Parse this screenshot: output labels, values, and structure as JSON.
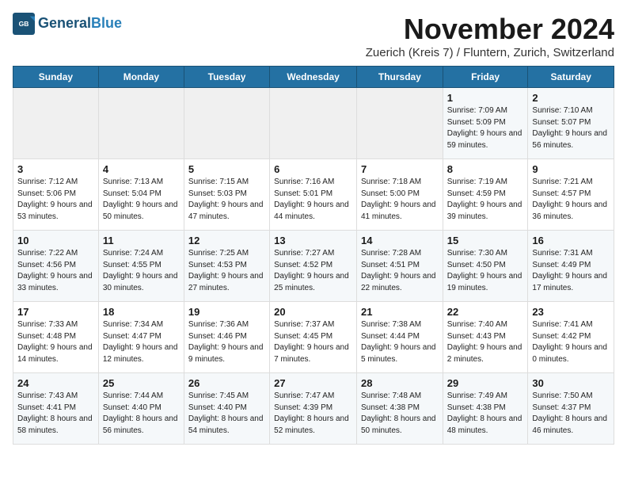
{
  "header": {
    "logo_line1": "General",
    "logo_line2": "Blue",
    "month_title": "November 2024",
    "location": "Zuerich (Kreis 7) / Fluntern, Zurich, Switzerland"
  },
  "days_of_week": [
    "Sunday",
    "Monday",
    "Tuesday",
    "Wednesday",
    "Thursday",
    "Friday",
    "Saturday"
  ],
  "weeks": [
    [
      {
        "day": "",
        "info": ""
      },
      {
        "day": "",
        "info": ""
      },
      {
        "day": "",
        "info": ""
      },
      {
        "day": "",
        "info": ""
      },
      {
        "day": "",
        "info": ""
      },
      {
        "day": "1",
        "info": "Sunrise: 7:09 AM\nSunset: 5:09 PM\nDaylight: 9 hours and 59 minutes."
      },
      {
        "day": "2",
        "info": "Sunrise: 7:10 AM\nSunset: 5:07 PM\nDaylight: 9 hours and 56 minutes."
      }
    ],
    [
      {
        "day": "3",
        "info": "Sunrise: 7:12 AM\nSunset: 5:06 PM\nDaylight: 9 hours and 53 minutes."
      },
      {
        "day": "4",
        "info": "Sunrise: 7:13 AM\nSunset: 5:04 PM\nDaylight: 9 hours and 50 minutes."
      },
      {
        "day": "5",
        "info": "Sunrise: 7:15 AM\nSunset: 5:03 PM\nDaylight: 9 hours and 47 minutes."
      },
      {
        "day": "6",
        "info": "Sunrise: 7:16 AM\nSunset: 5:01 PM\nDaylight: 9 hours and 44 minutes."
      },
      {
        "day": "7",
        "info": "Sunrise: 7:18 AM\nSunset: 5:00 PM\nDaylight: 9 hours and 41 minutes."
      },
      {
        "day": "8",
        "info": "Sunrise: 7:19 AM\nSunset: 4:59 PM\nDaylight: 9 hours and 39 minutes."
      },
      {
        "day": "9",
        "info": "Sunrise: 7:21 AM\nSunset: 4:57 PM\nDaylight: 9 hours and 36 minutes."
      }
    ],
    [
      {
        "day": "10",
        "info": "Sunrise: 7:22 AM\nSunset: 4:56 PM\nDaylight: 9 hours and 33 minutes."
      },
      {
        "day": "11",
        "info": "Sunrise: 7:24 AM\nSunset: 4:55 PM\nDaylight: 9 hours and 30 minutes."
      },
      {
        "day": "12",
        "info": "Sunrise: 7:25 AM\nSunset: 4:53 PM\nDaylight: 9 hours and 27 minutes."
      },
      {
        "day": "13",
        "info": "Sunrise: 7:27 AM\nSunset: 4:52 PM\nDaylight: 9 hours and 25 minutes."
      },
      {
        "day": "14",
        "info": "Sunrise: 7:28 AM\nSunset: 4:51 PM\nDaylight: 9 hours and 22 minutes."
      },
      {
        "day": "15",
        "info": "Sunrise: 7:30 AM\nSunset: 4:50 PM\nDaylight: 9 hours and 19 minutes."
      },
      {
        "day": "16",
        "info": "Sunrise: 7:31 AM\nSunset: 4:49 PM\nDaylight: 9 hours and 17 minutes."
      }
    ],
    [
      {
        "day": "17",
        "info": "Sunrise: 7:33 AM\nSunset: 4:48 PM\nDaylight: 9 hours and 14 minutes."
      },
      {
        "day": "18",
        "info": "Sunrise: 7:34 AM\nSunset: 4:47 PM\nDaylight: 9 hours and 12 minutes."
      },
      {
        "day": "19",
        "info": "Sunrise: 7:36 AM\nSunset: 4:46 PM\nDaylight: 9 hours and 9 minutes."
      },
      {
        "day": "20",
        "info": "Sunrise: 7:37 AM\nSunset: 4:45 PM\nDaylight: 9 hours and 7 minutes."
      },
      {
        "day": "21",
        "info": "Sunrise: 7:38 AM\nSunset: 4:44 PM\nDaylight: 9 hours and 5 minutes."
      },
      {
        "day": "22",
        "info": "Sunrise: 7:40 AM\nSunset: 4:43 PM\nDaylight: 9 hours and 2 minutes."
      },
      {
        "day": "23",
        "info": "Sunrise: 7:41 AM\nSunset: 4:42 PM\nDaylight: 9 hours and 0 minutes."
      }
    ],
    [
      {
        "day": "24",
        "info": "Sunrise: 7:43 AM\nSunset: 4:41 PM\nDaylight: 8 hours and 58 minutes."
      },
      {
        "day": "25",
        "info": "Sunrise: 7:44 AM\nSunset: 4:40 PM\nDaylight: 8 hours and 56 minutes."
      },
      {
        "day": "26",
        "info": "Sunrise: 7:45 AM\nSunset: 4:40 PM\nDaylight: 8 hours and 54 minutes."
      },
      {
        "day": "27",
        "info": "Sunrise: 7:47 AM\nSunset: 4:39 PM\nDaylight: 8 hours and 52 minutes."
      },
      {
        "day": "28",
        "info": "Sunrise: 7:48 AM\nSunset: 4:38 PM\nDaylight: 8 hours and 50 minutes."
      },
      {
        "day": "29",
        "info": "Sunrise: 7:49 AM\nSunset: 4:38 PM\nDaylight: 8 hours and 48 minutes."
      },
      {
        "day": "30",
        "info": "Sunrise: 7:50 AM\nSunset: 4:37 PM\nDaylight: 8 hours and 46 minutes."
      }
    ]
  ]
}
